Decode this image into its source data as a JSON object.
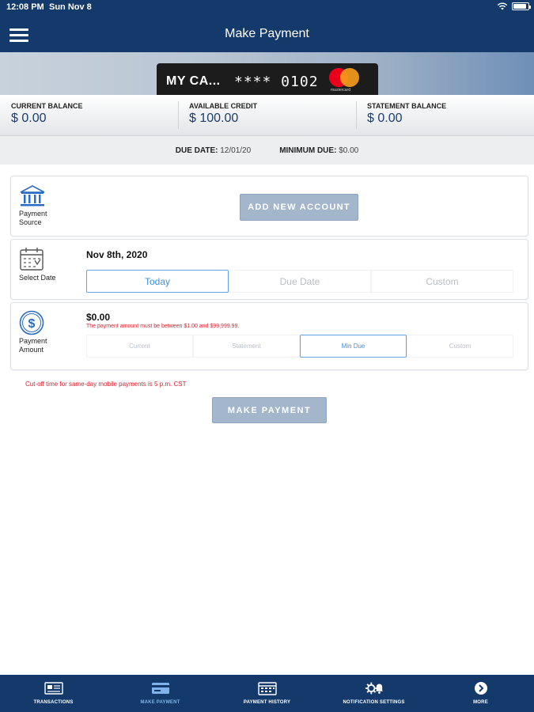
{
  "status_bar": {
    "time": "12:08 PM",
    "date": "Sun Nov 8"
  },
  "header": {
    "title": "Make Payment"
  },
  "card": {
    "name": "MY CA...",
    "number": "**** 0102",
    "brand": "mastercard"
  },
  "balances": [
    {
      "label": "CURRENT BALANCE",
      "value": "$ 0.00"
    },
    {
      "label": "AVAILABLE CREDIT",
      "value": "$ 100.00"
    },
    {
      "label": "STATEMENT BALANCE",
      "value": "$ 0.00"
    }
  ],
  "due": {
    "date_label": "DUE DATE:",
    "date_value": "12/01/20",
    "min_label": "MINIMUM DUE:",
    "min_value": "$0.00"
  },
  "payment_source": {
    "label": "Payment Source",
    "icon": "bank-icon",
    "add_button": "ADD NEW ACCOUNT"
  },
  "select_date": {
    "label": "Select Date",
    "icon": "calendar-icon",
    "selected_date": "Nov 8th, 2020",
    "options": [
      "Today",
      "Due Date",
      "Custom"
    ],
    "active": "Today"
  },
  "payment_amount": {
    "label": "Payment Amount",
    "icon": "dollar-circle-icon",
    "value": "$0.00",
    "error": "The payment amount must be between $1.00 and $99,999.99.",
    "options": [
      "Current",
      "Statement",
      "Min Due",
      "Custom"
    ],
    "active": "Min Due"
  },
  "cutoff_note": "Cut-off time for same-day mobile payments is 5 p.m. CST",
  "make_payment_button": "MAKE PAYMENT",
  "bottom_nav": [
    {
      "label": "TRANSACTIONS",
      "icon": "transactions-icon"
    },
    {
      "label": "MAKE PAYMENT",
      "icon": "card-payment-icon",
      "active": true
    },
    {
      "label": "PAYMENT HISTORY",
      "icon": "calendar-grid-icon"
    },
    {
      "label": "NOTIFICATION SETTINGS",
      "icon": "gear-bell-icon"
    },
    {
      "label": "MORE",
      "icon": "chevron-right-circle-icon"
    }
  ],
  "colors": {
    "header": "#143a6b",
    "button": "#a4b6cb",
    "accent": "#3e8fe0",
    "error": "#d9232f"
  }
}
